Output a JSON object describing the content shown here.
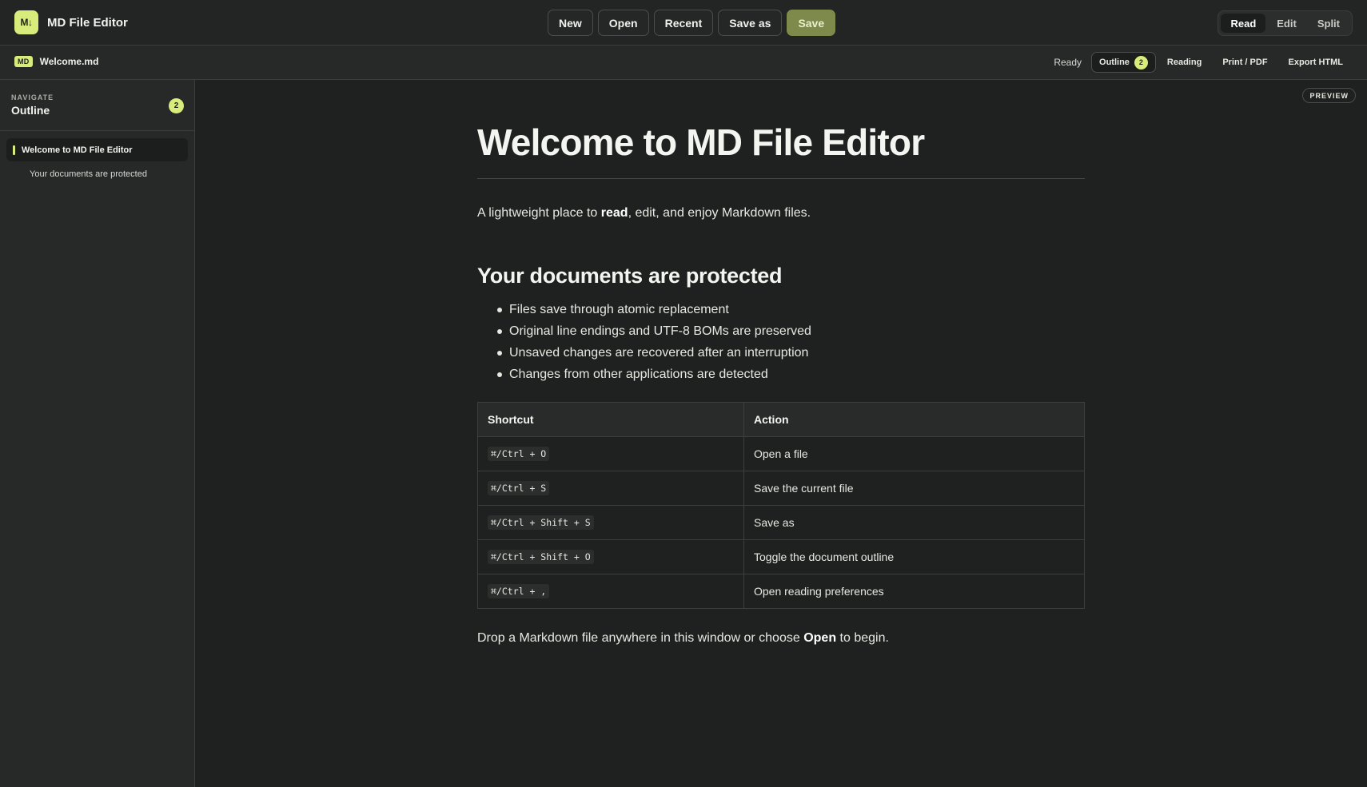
{
  "app": {
    "logo_text": "M↓",
    "title": "MD File Editor"
  },
  "toolbar": {
    "new_label": "New",
    "open_label": "Open",
    "recent_label": "Recent",
    "save_as_label": "Save as",
    "save_label": "Save"
  },
  "modes": {
    "read": "Read",
    "edit": "Edit",
    "split": "Split",
    "active": "Read"
  },
  "subbar": {
    "file_badge": "MD",
    "file_name": "Welcome.md",
    "status": "Ready",
    "outline_label": "Outline",
    "outline_count": "2",
    "reading_label": "Reading",
    "print_label": "Print / PDF",
    "export_label": "Export HTML"
  },
  "sidebar": {
    "kicker": "NAVIGATE",
    "title": "Outline",
    "count": "2",
    "items": [
      {
        "label": "Welcome to MD File Editor",
        "level": 1,
        "active": true
      },
      {
        "label": "Your documents are protected",
        "level": 2,
        "active": false
      }
    ]
  },
  "main": {
    "preview_tag": "PREVIEW",
    "h1": "Welcome to MD File Editor",
    "intro": {
      "before": "A lightweight place to ",
      "bold": "read",
      "after": ", edit, and enjoy Markdown files."
    },
    "h2": "Your documents are protected",
    "bullets": [
      "Files save through atomic replacement",
      "Original line endings and UTF-8 BOMs are preserved",
      "Unsaved changes are recovered after an interruption",
      "Changes from other applications are detected"
    ],
    "table": {
      "headers": [
        "Shortcut",
        "Action"
      ],
      "rows": [
        {
          "shortcut": "⌘/Ctrl + O",
          "action": "Open a file"
        },
        {
          "shortcut": "⌘/Ctrl + S",
          "action": "Save the current file"
        },
        {
          "shortcut": "⌘/Ctrl + Shift + S",
          "action": "Save as"
        },
        {
          "shortcut": "⌘/Ctrl + Shift + O",
          "action": "Toggle the document outline"
        },
        {
          "shortcut": "⌘/Ctrl + ,",
          "action": "Open reading preferences"
        }
      ]
    },
    "outro": {
      "before": "Drop a Markdown file anywhere in this window or choose ",
      "bold": "Open",
      "after": " to begin."
    }
  },
  "colors": {
    "background": "#1f2120",
    "panel": "#272928",
    "accent": "#d7ec7a",
    "save_button": "#7e8a4c"
  }
}
